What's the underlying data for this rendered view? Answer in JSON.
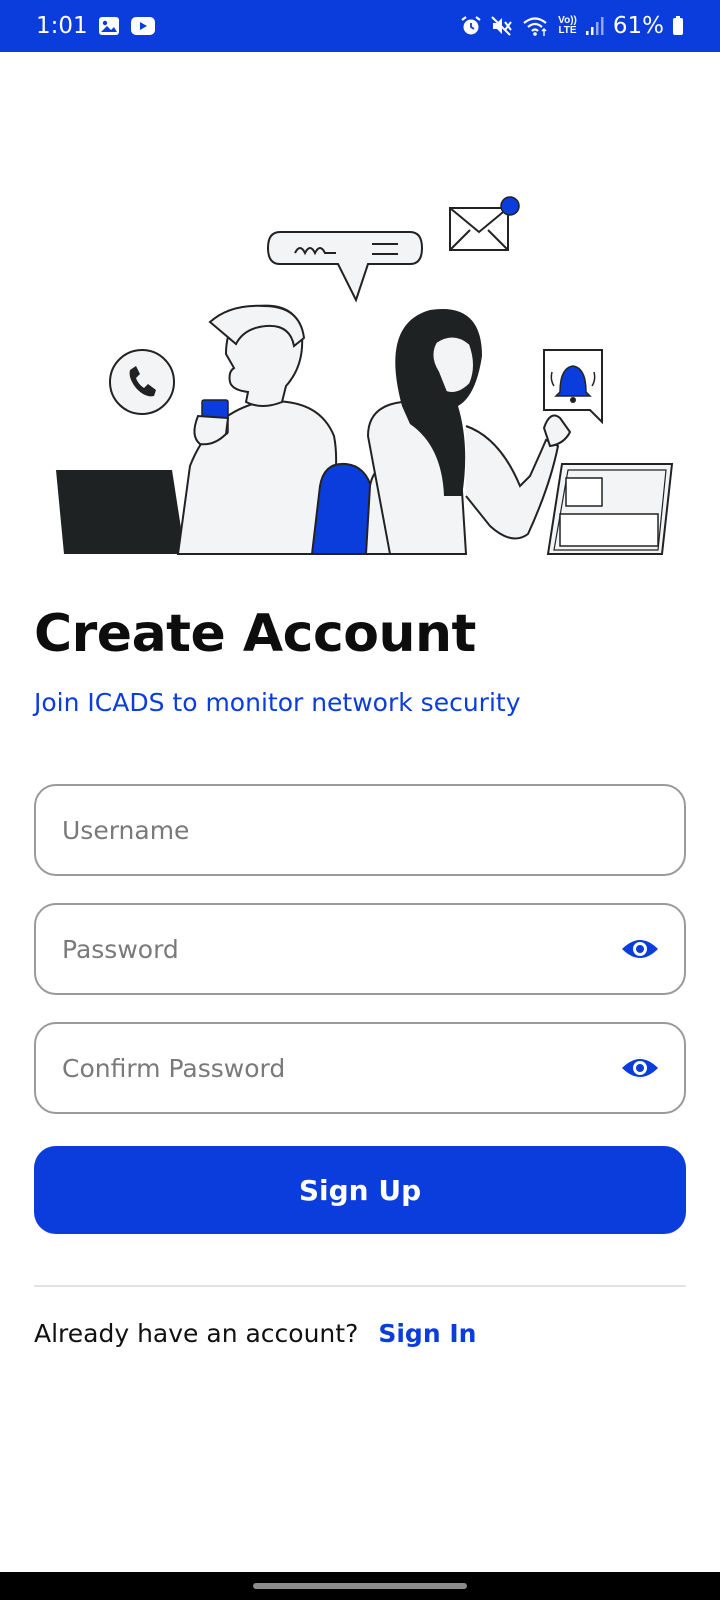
{
  "status_bar": {
    "time": "1:01",
    "battery": "61%",
    "left_icons": [
      "gallery-icon",
      "youtube-icon"
    ],
    "right_icons": [
      "alarm-icon",
      "mute-icon",
      "wifi-icon",
      "volte-icon",
      "signal-icon",
      "battery-icon"
    ],
    "volte_label_top": "Vo))",
    "volte_label_bottom": "LTE",
    "background": "#0a3ddc"
  },
  "illustration": {
    "name": "two-people-messaging-illustration",
    "accent": "#0a3ddc"
  },
  "header": {
    "title": "Create Account",
    "subtitle": "Join ICADS to monitor network security"
  },
  "form": {
    "username": {
      "value": "",
      "placeholder": "Username"
    },
    "password": {
      "value": "",
      "placeholder": "Password",
      "toggle_icon": "eye-icon"
    },
    "confirm_password": {
      "value": "",
      "placeholder": "Confirm Password",
      "toggle_icon": "eye-icon"
    },
    "submit_label": "Sign Up"
  },
  "footer": {
    "prompt": "Already have an account?",
    "link_label": "Sign In"
  },
  "colors": {
    "accent": "#0a3ddc",
    "field_border": "#9a9a9a",
    "placeholder": "#7a7a7a"
  }
}
